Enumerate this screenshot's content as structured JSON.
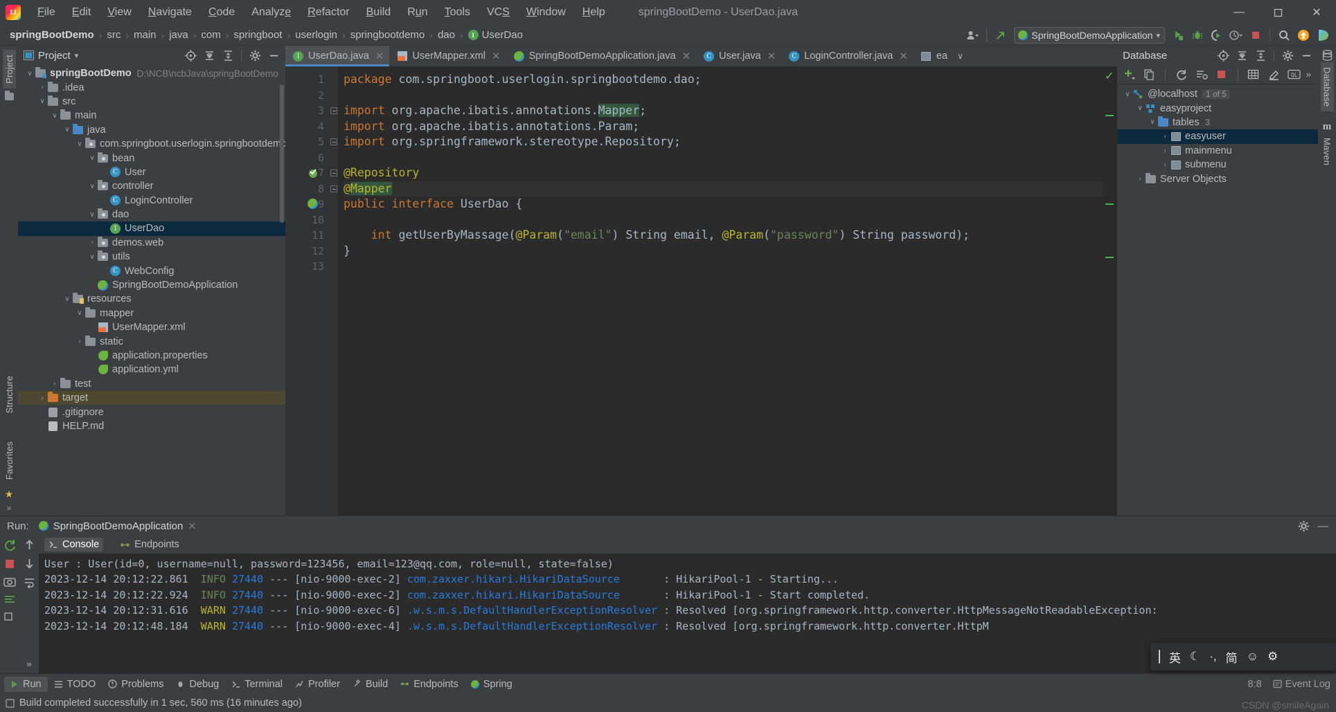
{
  "window": {
    "title": "springBootDemo - UserDao.java",
    "logo_text": "IJ",
    "minimize": "—",
    "maximize": "❐",
    "close": "✕"
  },
  "menu": [
    {
      "label": "File"
    },
    {
      "label": "Edit"
    },
    {
      "label": "View"
    },
    {
      "label": "Navigate"
    },
    {
      "label": "Code"
    },
    {
      "label": "Analyze"
    },
    {
      "label": "Refactor"
    },
    {
      "label": "Build"
    },
    {
      "label": "Run"
    },
    {
      "label": "Tools"
    },
    {
      "label": "VCS"
    },
    {
      "label": "Window"
    },
    {
      "label": "Help"
    }
  ],
  "breadcrumb": {
    "items": [
      "springBootDemo",
      "src",
      "main",
      "java",
      "com",
      "springboot",
      "userlogin",
      "springbootdemo",
      "dao",
      "UserDao"
    ],
    "separator": "›",
    "last_icon": "interface-icon"
  },
  "toolbar": {
    "run_config": "SpringBootDemoApplication",
    "run_config_caret": "▾",
    "buttons": [
      "user-icon",
      "update-project-icon",
      "run-icon",
      "debug-icon",
      "run-with-coverage-icon",
      "profiler-icon",
      "stop-icon",
      "search-icon",
      "updates-icon",
      "ide-icon"
    ]
  },
  "left_rail": {
    "labels": [
      "Project",
      "Structure",
      "Favorites"
    ]
  },
  "right_rail": {
    "labels": [
      "Database",
      "Maven"
    ]
  },
  "project_panel": {
    "title": "Project",
    "title_caret": "▾",
    "actions": [
      "locate-icon",
      "expand-all-icon",
      "collapse-all-icon",
      "settings-icon",
      "hide-icon"
    ],
    "tree": [
      {
        "depth": 0,
        "twist": "∨",
        "icon": "module-folder",
        "label": "springBootDemo",
        "bold": true,
        "path": "D:\\NCB\\ncbJava\\springBootDemo",
        "state": "normal"
      },
      {
        "depth": 1,
        "twist": "›",
        "icon": "folder",
        "label": ".idea",
        "state": "normal"
      },
      {
        "depth": 1,
        "twist": "∨",
        "icon": "folder",
        "label": "src",
        "state": "normal"
      },
      {
        "depth": 2,
        "twist": "∨",
        "icon": "folder",
        "label": "main",
        "state": "normal"
      },
      {
        "depth": 3,
        "twist": "∨",
        "icon": "source-folder",
        "label": "java",
        "state": "normal"
      },
      {
        "depth": 4,
        "twist": "∨",
        "icon": "package",
        "label": "com.springboot.userlogin.springbootdemo",
        "state": "normal"
      },
      {
        "depth": 5,
        "twist": "∨",
        "icon": "package",
        "label": "bean",
        "state": "normal"
      },
      {
        "depth": 6,
        "twist": "",
        "icon": "class",
        "label": "User",
        "state": "normal"
      },
      {
        "depth": 5,
        "twist": "∨",
        "icon": "package",
        "label": "controller",
        "state": "normal"
      },
      {
        "depth": 6,
        "twist": "",
        "icon": "class",
        "label": "LoginController",
        "state": "normal"
      },
      {
        "depth": 5,
        "twist": "∨",
        "icon": "package",
        "label": "dao",
        "state": "normal"
      },
      {
        "depth": 6,
        "twist": "",
        "icon": "interface",
        "label": "UserDao",
        "state": "selected"
      },
      {
        "depth": 5,
        "twist": "›",
        "icon": "package",
        "label": "demos.web",
        "state": "normal"
      },
      {
        "depth": 5,
        "twist": "∨",
        "icon": "package",
        "label": "utils",
        "state": "normal"
      },
      {
        "depth": 6,
        "twist": "",
        "icon": "class",
        "label": "WebConfig",
        "state": "normal"
      },
      {
        "depth": 5,
        "twist": "",
        "icon": "spring",
        "label": "SpringBootDemoApplication",
        "state": "normal"
      },
      {
        "depth": 3,
        "twist": "∨",
        "icon": "resource-folder",
        "label": "resources",
        "state": "normal"
      },
      {
        "depth": 4,
        "twist": "∨",
        "icon": "folder",
        "label": "mapper",
        "state": "normal"
      },
      {
        "depth": 5,
        "twist": "",
        "icon": "xml",
        "label": "UserMapper.xml",
        "state": "normal"
      },
      {
        "depth": 4,
        "twist": "›",
        "icon": "folder",
        "label": "static",
        "state": "normal"
      },
      {
        "depth": 5,
        "twist": "",
        "icon": "leaf",
        "label": "application.properties",
        "state": "normal"
      },
      {
        "depth": 5,
        "twist": "",
        "icon": "leaf",
        "label": "application.yml",
        "state": "normal"
      },
      {
        "depth": 2,
        "twist": "›",
        "icon": "folder",
        "label": "test",
        "state": "normal"
      },
      {
        "depth": 1,
        "twist": "›",
        "icon": "excluded-folder",
        "label": "target",
        "state": "highlighted"
      },
      {
        "depth": 1,
        "twist": "",
        "icon": "gitignore",
        "label": ".gitignore",
        "state": "normal"
      },
      {
        "depth": 1,
        "twist": "",
        "icon": "markdown",
        "label": "HELP.md",
        "state": "normal"
      }
    ]
  },
  "editor": {
    "tabs": [
      {
        "label": "UserDao.java",
        "icon": "interface",
        "active": true,
        "close": "✕"
      },
      {
        "label": "UserMapper.xml",
        "icon": "xml",
        "active": false,
        "close": "✕"
      },
      {
        "label": "SpringBootDemoApplication.java",
        "icon": "spring",
        "active": false,
        "close": "✕"
      },
      {
        "label": "User.java",
        "icon": "class",
        "active": false,
        "close": "✕"
      },
      {
        "label": "LoginController.java",
        "icon": "class",
        "active": false,
        "close": "✕"
      },
      {
        "label": "ea",
        "icon": "table",
        "active": false,
        "close": ""
      }
    ],
    "tabs_overflow": "∨",
    "line_numbers": [
      "1",
      "2",
      "3",
      "4",
      "5",
      "6",
      "7",
      "8",
      "9",
      "10",
      "11",
      "12",
      "13"
    ],
    "lines": [
      {
        "n": 1,
        "tokens": [
          {
            "t": "package ",
            "c": "kw"
          },
          {
            "t": "com.springboot.userlogin.springbootdemo.dao;",
            "c": "cls2"
          }
        ]
      },
      {
        "n": 2,
        "tokens": []
      },
      {
        "n": 3,
        "tokens": [
          {
            "t": "import ",
            "c": "kw"
          },
          {
            "t": "org.apache.ibatis.annotations.",
            "c": "cls2"
          },
          {
            "t": "Mapper",
            "c": "cls2 hl-green"
          },
          {
            "t": ";",
            "c": "cls2"
          }
        ]
      },
      {
        "n": 4,
        "tokens": [
          {
            "t": "import ",
            "c": "kw"
          },
          {
            "t": "org.apache.ibatis.annotations.Param;",
            "c": "cls2"
          }
        ]
      },
      {
        "n": 5,
        "tokens": [
          {
            "t": "import ",
            "c": "kw"
          },
          {
            "t": "org.springframework.stereotype.Repository;",
            "c": "cls2"
          }
        ]
      },
      {
        "n": 6,
        "tokens": []
      },
      {
        "n": 7,
        "tokens": [
          {
            "t": "@Repository",
            "c": "ann"
          }
        ]
      },
      {
        "n": 8,
        "tokens": [
          {
            "t": "@",
            "c": "ann"
          },
          {
            "t": "Mapper",
            "c": "ann hl-green"
          }
        ]
      },
      {
        "n": 9,
        "tokens": [
          {
            "t": "public interface ",
            "c": "kw"
          },
          {
            "t": "UserDao ",
            "c": "cls2"
          },
          {
            "t": "{",
            "c": "cls2"
          }
        ]
      },
      {
        "n": 10,
        "tokens": []
      },
      {
        "n": 11,
        "tokens": [
          {
            "t": "    ",
            "c": "cls2"
          },
          {
            "t": "int ",
            "c": "kw"
          },
          {
            "t": "getUserByMassage",
            "c": "cls2"
          },
          {
            "t": "(",
            "c": "cls2"
          },
          {
            "t": "@Param",
            "c": "ann"
          },
          {
            "t": "(",
            "c": "cls2"
          },
          {
            "t": "\"email\"",
            "c": "str"
          },
          {
            "t": ") String email, ",
            "c": "cls2"
          },
          {
            "t": "@Param",
            "c": "ann"
          },
          {
            "t": "(",
            "c": "cls2"
          },
          {
            "t": "\"password\"",
            "c": "str"
          },
          {
            "t": ") String password);",
            "c": "cls2"
          }
        ]
      },
      {
        "n": 12,
        "tokens": [
          {
            "t": "}",
            "c": "cls2"
          }
        ]
      },
      {
        "n": 13,
        "tokens": []
      }
    ],
    "gutter_marks": {
      "7": "bean-icon",
      "9": "spring-icon"
    },
    "inspection_status": "✓"
  },
  "database_panel": {
    "title": "Database",
    "actions": [
      "locate-icon",
      "expand-all-icon",
      "collapse-all-icon",
      "settings-icon",
      "hide-icon"
    ],
    "toolbar": [
      "add-icon",
      "copy-icon",
      "refresh-icon",
      "sync-icon",
      "stop-icon",
      "table-icon",
      "edit-icon",
      "query-console-icon",
      "more-icon"
    ],
    "more_label": "»",
    "tree": [
      {
        "depth": 0,
        "twist": "∨",
        "icon": "connection",
        "label": "@localhost",
        "badge": "1 of 5",
        "state": "normal"
      },
      {
        "depth": 1,
        "twist": "∨",
        "icon": "schema",
        "label": "easyproject",
        "state": "normal"
      },
      {
        "depth": 2,
        "twist": "∨",
        "icon": "folder-blue",
        "label": "tables",
        "badge_plain": "3",
        "state": "normal"
      },
      {
        "depth": 3,
        "twist": "›",
        "icon": "table",
        "label": "easyuser",
        "state": "selected"
      },
      {
        "depth": 3,
        "twist": "›",
        "icon": "table",
        "label": "mainmenu",
        "state": "normal"
      },
      {
        "depth": 3,
        "twist": "›",
        "icon": "table",
        "label": "submenu",
        "state": "normal"
      },
      {
        "depth": 1,
        "twist": "›",
        "icon": "folder",
        "label": "Server Objects",
        "state": "normal"
      }
    ]
  },
  "run_panel": {
    "label": "Run:",
    "config_name": "SpringBootDemoApplication",
    "close": "✕",
    "settings_icon": "gear-icon",
    "hide_icon": "—",
    "console_tabs": [
      {
        "label": "Console",
        "icon": "console-icon",
        "active": true
      },
      {
        "label": "Endpoints",
        "icon": "endpoints-icon",
        "active": false
      }
    ],
    "side_buttons": [
      "rerun-icon",
      "stop-icon",
      "screenshot-icon",
      "thread-dump-icon",
      "filter-icon",
      "scroll-up-icon",
      "scroll-down-icon",
      "soft-wrap-icon",
      "more-icon"
    ],
    "console_lines": [
      {
        "segs": [
          {
            "t": "User : User(id=0, username=null, password=123456, email=123@qq.com, role=null, state=false)",
            "c": "c-plain"
          }
        ]
      },
      {
        "segs": [
          {
            "t": "2023-12-14 20:12:22.861 ",
            "c": "c-plain"
          },
          {
            "t": " INFO ",
            "c": "c-info"
          },
          {
            "t": "27440 ",
            "c": "c-pid"
          },
          {
            "t": "--- [nio-9000-exec-2] ",
            "c": "c-plain"
          },
          {
            "t": "com.zaxxer.hikari.HikariDataSource",
            "c": "c-cls"
          },
          {
            "t": "       : HikariPool-1 - Starting...",
            "c": "c-plain"
          }
        ]
      },
      {
        "segs": [
          {
            "t": "2023-12-14 20:12:22.924 ",
            "c": "c-plain"
          },
          {
            "t": " INFO ",
            "c": "c-info"
          },
          {
            "t": "27440 ",
            "c": "c-pid"
          },
          {
            "t": "--- [nio-9000-exec-2] ",
            "c": "c-plain"
          },
          {
            "t": "com.zaxxer.hikari.HikariDataSource",
            "c": "c-cls"
          },
          {
            "t": "       : HikariPool-1 - Start completed.",
            "c": "c-plain"
          }
        ]
      },
      {
        "segs": [
          {
            "t": "2023-12-14 20:12:31.616 ",
            "c": "c-plain"
          },
          {
            "t": " WARN ",
            "c": "c-warn"
          },
          {
            "t": "27440 ",
            "c": "c-pid"
          },
          {
            "t": "--- [nio-9000-exec-6] ",
            "c": "c-plain"
          },
          {
            "t": ".w.s.m.s.DefaultHandlerExceptionResolver",
            "c": "c-cls"
          },
          {
            "t": " : Resolved [org.springframework.http.converter.HttpMessageNotReadableException:",
            "c": "c-plain"
          }
        ]
      },
      {
        "segs": [
          {
            "t": "2023-12-14 20:12:48.184 ",
            "c": "c-plain"
          },
          {
            "t": " WARN ",
            "c": "c-warn"
          },
          {
            "t": "27440 ",
            "c": "c-pid"
          },
          {
            "t": "--- [nio-9000-exec-4] ",
            "c": "c-plain"
          },
          {
            "t": ".w.s.m.s.DefaultHandlerExceptionResolver",
            "c": "c-cls"
          },
          {
            "t": " : Resolved [org.springframework.http.converter.HttpM",
            "c": "c-plain"
          }
        ]
      }
    ]
  },
  "statusbar": {
    "items": [
      {
        "label": "Run",
        "icon": "run-icon",
        "active": true
      },
      {
        "label": "TODO",
        "icon": "todo-icon"
      },
      {
        "label": "Problems",
        "icon": "problems-icon"
      },
      {
        "label": "Debug",
        "icon": "debug-icon"
      },
      {
        "label": "Terminal",
        "icon": "terminal-icon"
      },
      {
        "label": "Profiler",
        "icon": "profiler-icon"
      },
      {
        "label": "Build",
        "icon": "build-icon"
      },
      {
        "label": "Endpoints",
        "icon": "endpoints-icon"
      },
      {
        "label": "Spring",
        "icon": "spring-icon"
      }
    ],
    "right": [
      {
        "label": "8:8"
      },
      {
        "label": "Event Log",
        "icon": "event-log-icon"
      }
    ]
  },
  "message_bar": {
    "text": "Build completed successfully in 1 sec, 560 ms (16 minutes ago)",
    "icon": "build-status-icon"
  },
  "ime_bar": {
    "items": [
      "英",
      "☾",
      "·,",
      "简",
      "☺",
      "⚙"
    ],
    "cursor": "|"
  },
  "watermark": "CSDN @smileAgain"
}
